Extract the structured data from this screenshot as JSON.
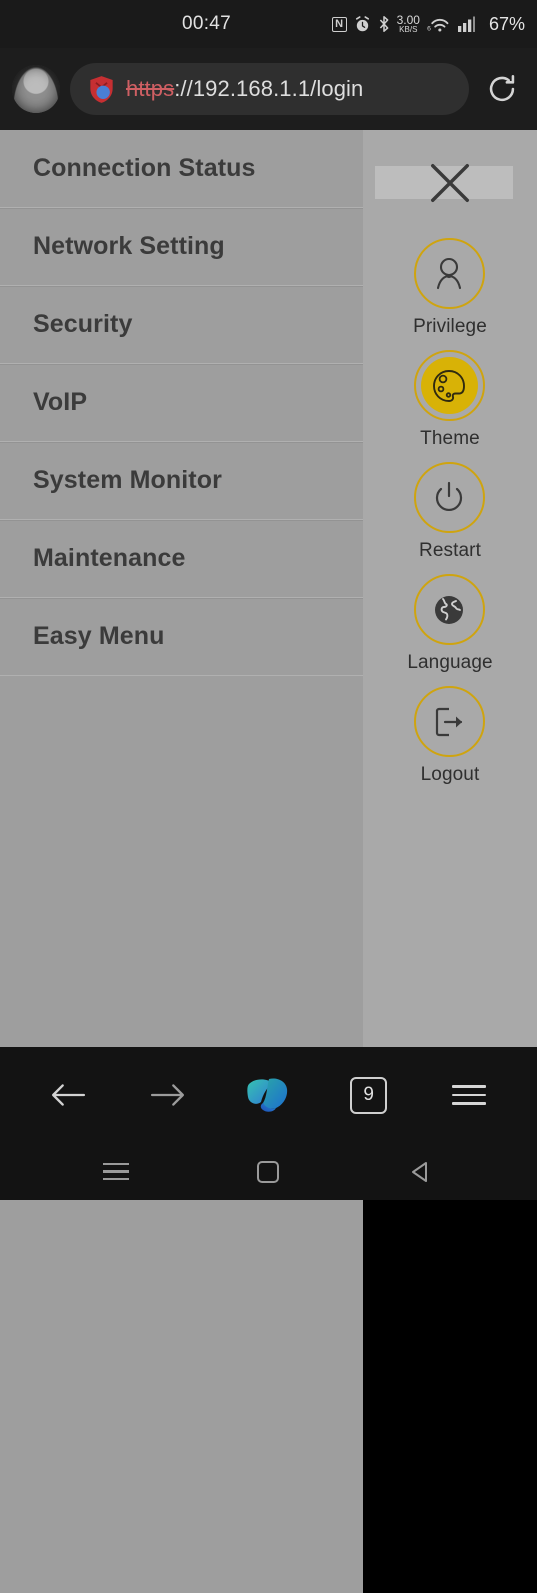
{
  "status_bar": {
    "clock": "00:47",
    "icons": [
      "nfc-icon",
      "alarm-icon",
      "bluetooth-icon",
      "wifi-icon",
      "cellular-signal-icon"
    ],
    "nfc_glyph": "N",
    "data_rate_value": "3.00",
    "data_rate_unit": "KB/S",
    "wifi_generation": "6",
    "battery": "67%"
  },
  "browser_top": {
    "avatar_label": "profile-avatar",
    "security_icon": "shield-icon",
    "url_scheme": "https",
    "url_rest": "://192.168.1.1/login",
    "reload_icon": "reload-icon"
  },
  "menu": {
    "items": [
      {
        "label": "Connection Status"
      },
      {
        "label": "Network Setting"
      },
      {
        "label": "Security"
      },
      {
        "label": "VoIP"
      },
      {
        "label": "System Monitor"
      },
      {
        "label": "Maintenance"
      },
      {
        "label": "Easy Menu"
      }
    ]
  },
  "tool_panel": {
    "close_icon": "close-icon",
    "accent_color": "#cfa40f",
    "theme_fill_color": "#d8b206",
    "tools": [
      {
        "label": "Privilege",
        "icon": "user-icon",
        "active": false
      },
      {
        "label": "Theme",
        "icon": "palette-icon",
        "active": true
      },
      {
        "label": "Restart",
        "icon": "power-icon",
        "active": false
      },
      {
        "label": "Language",
        "icon": "globe-icon",
        "active": false
      },
      {
        "label": "Logout",
        "icon": "logout-icon",
        "active": false
      }
    ]
  },
  "browser_bottom": {
    "back_icon": "arrow-back-icon",
    "forward_icon": "arrow-forward-icon",
    "copilot_icon": "copilot-icon",
    "tab_count": "9",
    "menu_icon": "hamburger-menu-icon"
  },
  "android_nav": {
    "recents_icon": "recent-apps-icon",
    "home_icon": "home-icon",
    "back_icon": "back-triangle-icon"
  }
}
